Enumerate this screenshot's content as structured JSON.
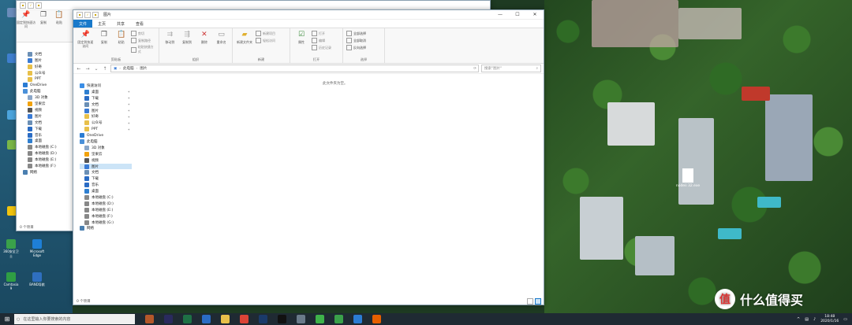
{
  "back_window": {
    "title": "",
    "file_tab": "文件",
    "ribbon_pin_label": "固定到快速访问",
    "ribbon_copy_label": "复制",
    "ribbon_paste_label": "粘贴",
    "nav_items": [
      {
        "label": "文档",
        "icon": "document-icon"
      },
      {
        "label": "图片",
        "icon": "picture-icon"
      },
      {
        "label": "好奇",
        "icon": "folder-icon"
      },
      {
        "label": "公众号",
        "icon": "folder-icon"
      },
      {
        "label": "PPT",
        "icon": "folder-icon"
      },
      {
        "label": "OneDrive",
        "icon": "cloud-icon"
      },
      {
        "label": "此电脑",
        "icon": "pc-icon"
      },
      {
        "label": "3D 对象",
        "icon": "cube-icon"
      },
      {
        "label": "坚果云",
        "icon": "nut-cloud-icon"
      },
      {
        "label": "视频",
        "icon": "video-icon"
      },
      {
        "label": "图片",
        "icon": "picture-icon"
      },
      {
        "label": "文档",
        "icon": "document-icon"
      },
      {
        "label": "下载",
        "icon": "download-icon"
      },
      {
        "label": "音乐",
        "icon": "music-icon"
      },
      {
        "label": "桌面",
        "icon": "desktop-icon"
      },
      {
        "label": "本地磁盘 (C:)",
        "icon": "drive-icon"
      },
      {
        "label": "本地磁盘 (D:)",
        "icon": "drive-icon"
      },
      {
        "label": "本地磁盘 (E:)",
        "icon": "drive-icon"
      },
      {
        "label": "本地磁盘 (F:)",
        "icon": "drive-icon"
      },
      {
        "label": "网络",
        "icon": "network-icon"
      }
    ],
    "status": "0 个项目"
  },
  "main_window": {
    "title": "图片",
    "tabs": [
      "文件",
      "主页",
      "共享",
      "查看"
    ],
    "ribbon": {
      "groups": [
        {
          "name": "剪贴板",
          "buttons": [
            "固定到快速访问",
            "复制",
            "粘贴"
          ],
          "small": [
            "剪切",
            "复制路径",
            "粘贴快捷方式"
          ]
        },
        {
          "name": "组织",
          "buttons": [
            "移动到",
            "复制到",
            "删除",
            "重命名"
          ],
          "small": []
        },
        {
          "name": "新建",
          "buttons": [
            "新建文件夹"
          ],
          "small": [
            "新建项目",
            "轻松访问"
          ]
        },
        {
          "name": "打开",
          "buttons": [
            "属性"
          ],
          "small": [
            "打开",
            "编辑",
            "历史记录"
          ]
        },
        {
          "name": "选择",
          "buttons": [],
          "small": [
            "全部选择",
            "全部取消",
            "反向选择"
          ]
        }
      ]
    },
    "address": {
      "segments": [
        "此电脑",
        "图片"
      ],
      "search_placeholder": "搜索\"图片\""
    },
    "empty_message": "此文件夹为空。",
    "nav": {
      "quick_access": "快速访问",
      "quick_items": [
        {
          "label": "桌面",
          "icon": "desktop-icon",
          "pinned": true
        },
        {
          "label": "下载",
          "icon": "download-icon",
          "pinned": true
        },
        {
          "label": "文档",
          "icon": "document-icon",
          "pinned": true
        },
        {
          "label": "图片",
          "icon": "picture-icon",
          "pinned": true
        },
        {
          "label": "好奇",
          "icon": "folder-icon",
          "pinned": true
        },
        {
          "label": "公众号",
          "icon": "folder-icon",
          "pinned": true
        },
        {
          "label": "PPT",
          "icon": "folder-icon",
          "pinned": true
        }
      ],
      "onedrive": "OneDrive",
      "this_pc": "此电脑",
      "pc_items": [
        {
          "label": "3D 对象",
          "icon": "cube-icon",
          "selected": false
        },
        {
          "label": "坚果云",
          "icon": "nut-cloud-icon",
          "selected": false
        },
        {
          "label": "视频",
          "icon": "video-icon",
          "selected": false
        },
        {
          "label": "图片",
          "icon": "picture-icon",
          "selected": true
        },
        {
          "label": "文档",
          "icon": "document-icon",
          "selected": false
        },
        {
          "label": "下载",
          "icon": "download-icon",
          "selected": false
        },
        {
          "label": "音乐",
          "icon": "music-icon",
          "selected": false
        },
        {
          "label": "桌面",
          "icon": "desktop-icon",
          "selected": false
        },
        {
          "label": "本地磁盘 (C:)",
          "icon": "drive-icon",
          "selected": false
        },
        {
          "label": "本地磁盘 (D:)",
          "icon": "drive-icon",
          "selected": false
        },
        {
          "label": "本地磁盘 (E:)",
          "icon": "drive-icon",
          "selected": false
        },
        {
          "label": "本地磁盘 (F:)",
          "icon": "drive-icon",
          "selected": false
        },
        {
          "label": "本地磁盘 (G:)",
          "icon": "drive-icon",
          "selected": false
        }
      ],
      "network": "网络"
    },
    "status": "0 个项目"
  },
  "desktop": {
    "icons": [
      "Microsoft Edge",
      "360安全卫士",
      "Camtasia 9",
      "BAND导航"
    ],
    "file": "nodeii 32.exe"
  },
  "taskbar": {
    "search_placeholder": "在这里输入你要搜索的内容",
    "time": "18:48",
    "date": "2020/1/16",
    "apps": [
      "word-app",
      "pr-app",
      "excel-app",
      "mail-app",
      "folder-app",
      "chrome-app",
      "ps-app",
      "qq-app",
      "monitor-app",
      "wechat-app",
      "green-app",
      "blue-app",
      "firefox-app"
    ]
  },
  "watermark": {
    "badge": "值",
    "text": "什么值得买"
  },
  "colors": {
    "accent": "#1979ca",
    "selected": "#cce4f7",
    "taskbar": "#1f2a33"
  }
}
